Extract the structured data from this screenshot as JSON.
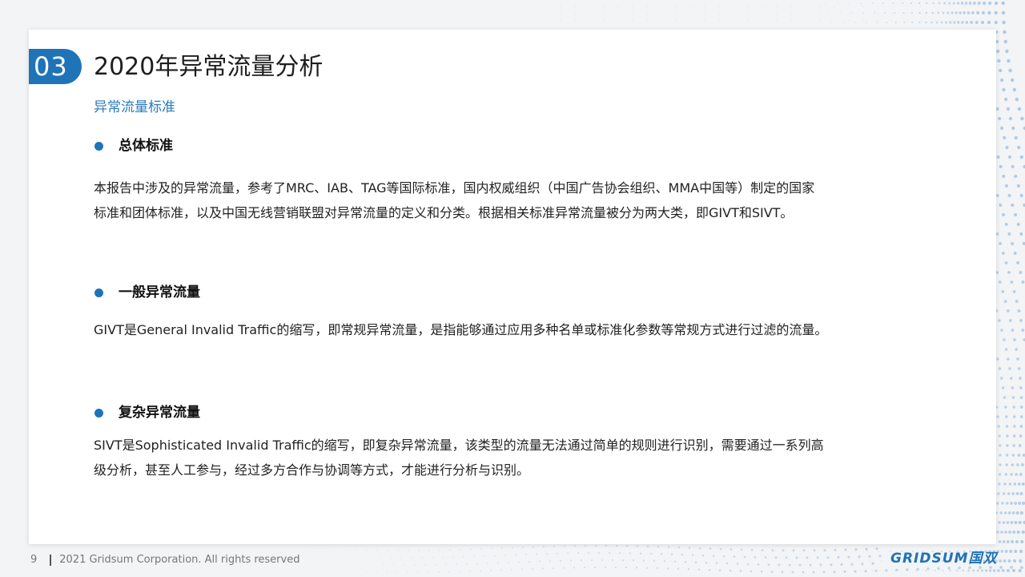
{
  "slide": {
    "section_number": "03",
    "title": "2020年异常流量分析",
    "subtitle": "异常流量标准"
  },
  "sections": [
    {
      "heading": "总体标准",
      "lines": [
        "本报告中涉及的异常流量，参考了MRC、IAB、TAG等国际标准，国内权威组织（中国广告协会组织、MMA中国等）制定的国家",
        "标准和团体标准，以及中国无线营销联盟对异常流量的定义和分类。根据相关标准异常流量被分为两大类，即GIVT和SIVT。"
      ]
    },
    {
      "heading": "一般异常流量",
      "lines": [
        "GIVT是General Invalid Traffic的缩写，即常规异常流量，是指能够通过应用多种名单或标准化参数等常规方式进行过滤的流量。"
      ]
    },
    {
      "heading": "复杂异常流量",
      "lines": [
        "SIVT是Sophisticated Invalid Traffic的缩写，即复杂异常流量，该类型的流量无法通过简单的规则进行识别，需要通过一系列高",
        "级分析，甚至人工参与，经过多方合作与协调等方式，才能进行分析与识别。"
      ]
    }
  ],
  "footer": {
    "page_number": "9",
    "copyright": "2021 Gridsum Corporation. All rights reserved"
  },
  "logo": {
    "text": "GRIDSUM国双"
  },
  "colors": {
    "accent": "#1f73b7",
    "subtitle": "#2b7bbd"
  }
}
